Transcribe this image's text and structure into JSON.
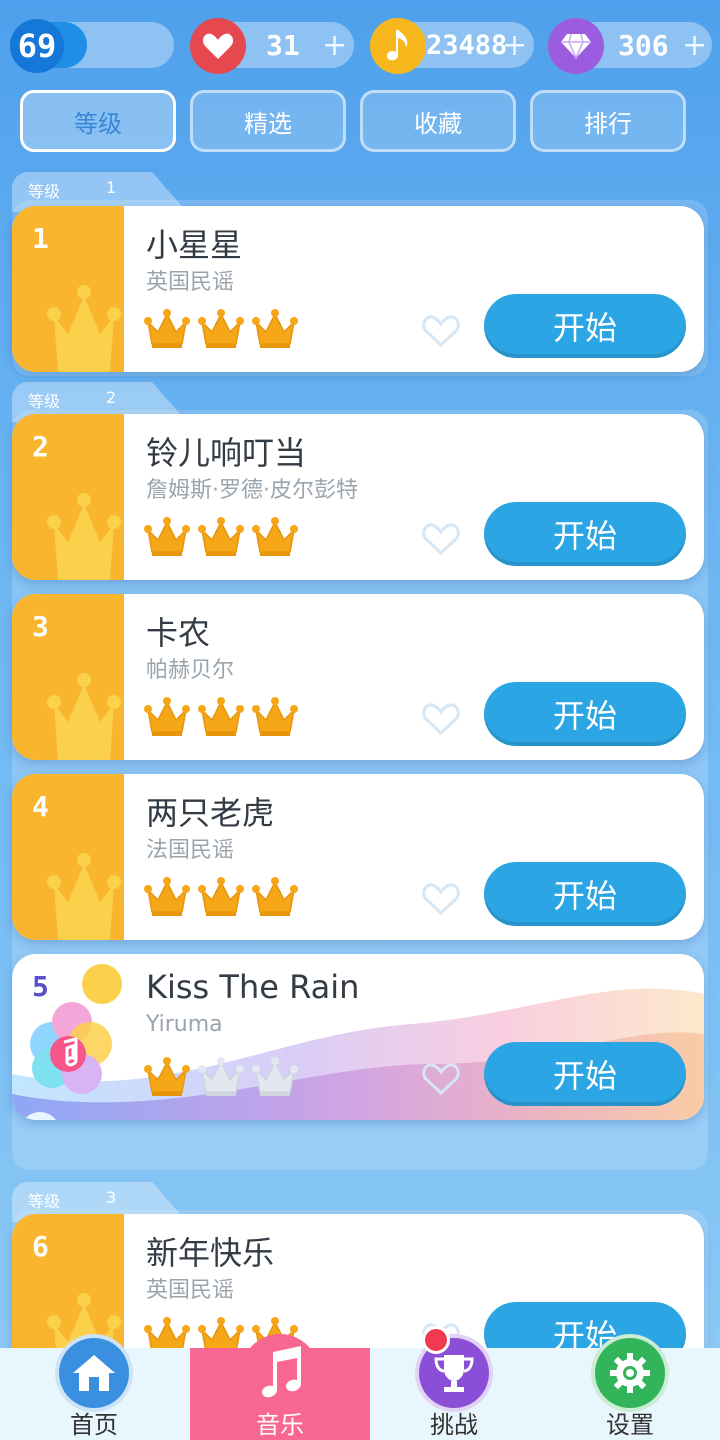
{
  "topbar": {
    "level": "69",
    "level_progress": 0.46,
    "hearts": "31",
    "notes": "23488",
    "gems": "306",
    "plus": "+"
  },
  "tabs": [
    {
      "label": "等级",
      "active": true
    },
    {
      "label": "精选",
      "active": false
    },
    {
      "label": "收藏",
      "active": false
    },
    {
      "label": "排行",
      "active": false
    }
  ],
  "groups": [
    {
      "label": "等级",
      "num": "1"
    },
    {
      "label": "等级",
      "num": "2"
    },
    {
      "label": "等级",
      "num": "3"
    }
  ],
  "songs": [
    {
      "num": "1",
      "title": "小星星",
      "artist": "英国民谣",
      "stars": 3,
      "button": "开始"
    },
    {
      "num": "2",
      "title": "铃儿响叮当",
      "artist": "詹姆斯·罗德·皮尔彭特",
      "stars": 3,
      "button": "开始"
    },
    {
      "num": "3",
      "title": "卡农",
      "artist": "帕赫贝尔",
      "stars": 3,
      "button": "开始"
    },
    {
      "num": "4",
      "title": "两只老虎",
      "artist": "法国民谣",
      "stars": 3,
      "button": "开始"
    },
    {
      "num": "5",
      "title": "Kiss The Rain",
      "artist": "Yiruma",
      "stars": 1,
      "button": "开始"
    },
    {
      "num": "6",
      "title": "新年快乐",
      "artist": "英国民谣",
      "stars": 3,
      "button": "开始"
    }
  ],
  "nav": [
    {
      "label": "首页",
      "icon": "home-icon",
      "color": "#3a8fe0"
    },
    {
      "label": "音乐",
      "icon": "music-note-icon",
      "color": "#f86792"
    },
    {
      "label": "挑战",
      "icon": "trophy-icon",
      "color": "#8a4fd6"
    },
    {
      "label": "设置",
      "icon": "gear-icon",
      "color": "#32b45a"
    }
  ],
  "colors": {
    "accent_blue": "#2ba5e3",
    "crown_orange": "#f9b52e",
    "nav_active": "#f86792"
  }
}
